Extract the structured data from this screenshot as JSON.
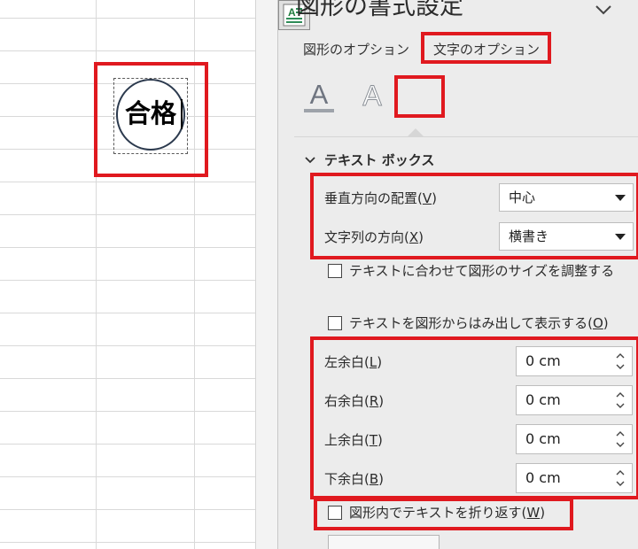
{
  "shape": {
    "text": "合格"
  },
  "pane": {
    "title": "図形の書式設定",
    "tabs": {
      "shape_options": "図形のオプション",
      "text_options": "文字のオプション"
    },
    "icons": {
      "fill": "text-fill-icon",
      "outline": "text-outline-icon",
      "layout": "text-layout-icon"
    },
    "section": {
      "label": "テキスト ボックス"
    },
    "vertical_alignment": {
      "label_main": "垂直方向の配置(",
      "label_key": "V",
      "label_end": ")",
      "value": "中心"
    },
    "text_direction": {
      "label_main": "文字列の方向(",
      "label_key": "X",
      "label_end": ")",
      "value": "横書き"
    },
    "checkboxes": {
      "resize_shape": "テキストに合わせて図形のサイズを調整する",
      "overflow": {
        "main": "テキストを図形からはみ出して表示する(",
        "key": "O",
        "end": ")"
      },
      "wrap_text": {
        "main": "図形内でテキストを折り返す(",
        "key": "W",
        "end": ")"
      }
    },
    "margins": {
      "left": {
        "main": "左余白(",
        "key": "L",
        "end": ")",
        "value": "0 cm"
      },
      "right": {
        "main": "右余白(",
        "key": "R",
        "end": ")",
        "value": "0 cm"
      },
      "top": {
        "main": "上余白(",
        "key": "T",
        "end": ")",
        "value": "0 cm"
      },
      "bottom": {
        "main": "下余白(",
        "key": "B",
        "end": ")",
        "value": "0 cm"
      }
    }
  },
  "colors": {
    "highlight": "#e0191f",
    "pane_background": "#ececec",
    "grid_line": "#d9d9d9",
    "shape_outline": "#2c3a4e"
  }
}
